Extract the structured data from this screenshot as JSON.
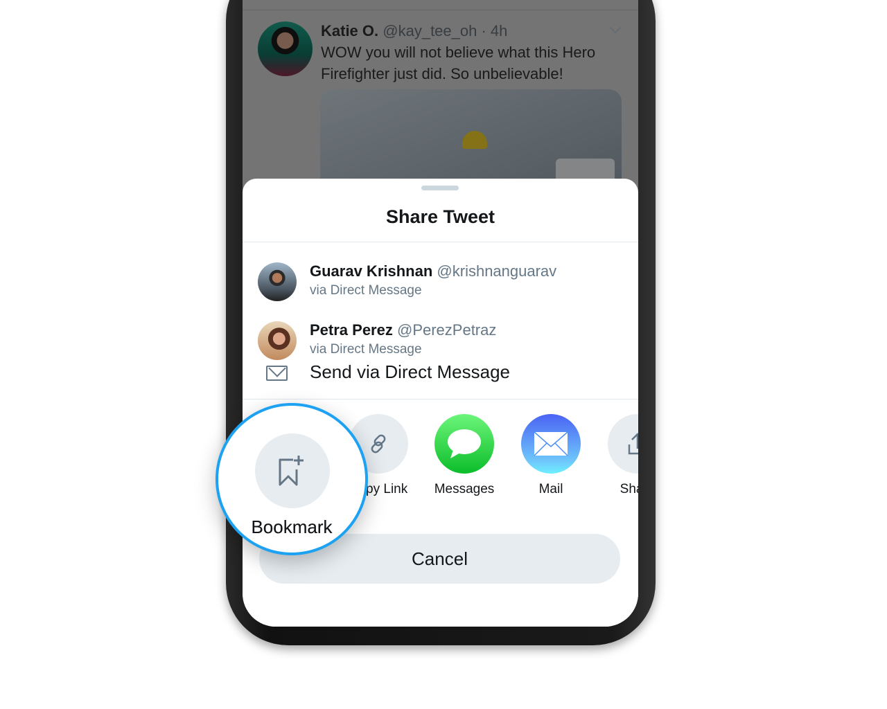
{
  "tweet": {
    "author": "Katie O.",
    "handle": "@kay_tee_oh",
    "time": "· 4h",
    "text": "WOW you will not believe what this Hero Firefighter just did. So unbelievable!"
  },
  "sheet": {
    "title": "Share Tweet",
    "contacts": [
      {
        "name": "Guarav Krishnan",
        "handle": "@krishnanguarav",
        "via": "via Direct Message"
      },
      {
        "name": "Petra Perez",
        "handle": "@PerezPetraz",
        "via": "via Direct Message"
      }
    ],
    "send_dm": "Send via Direct Message",
    "apps": [
      {
        "label": "Bookmark",
        "icon": "bookmark-plus-icon"
      },
      {
        "label": "Copy Link",
        "icon": "link-icon"
      },
      {
        "label": "Messages",
        "icon": "messages-icon"
      },
      {
        "label": "Mail",
        "icon": "mail-icon"
      },
      {
        "label": "Share",
        "icon": "share-icon"
      }
    ],
    "cancel": "Cancel"
  },
  "magnifier": {
    "label": "Bookmark"
  },
  "colors": {
    "accent": "#1da1f2",
    "secondary_text": "#657786",
    "button_bg": "#e6ecf0"
  }
}
